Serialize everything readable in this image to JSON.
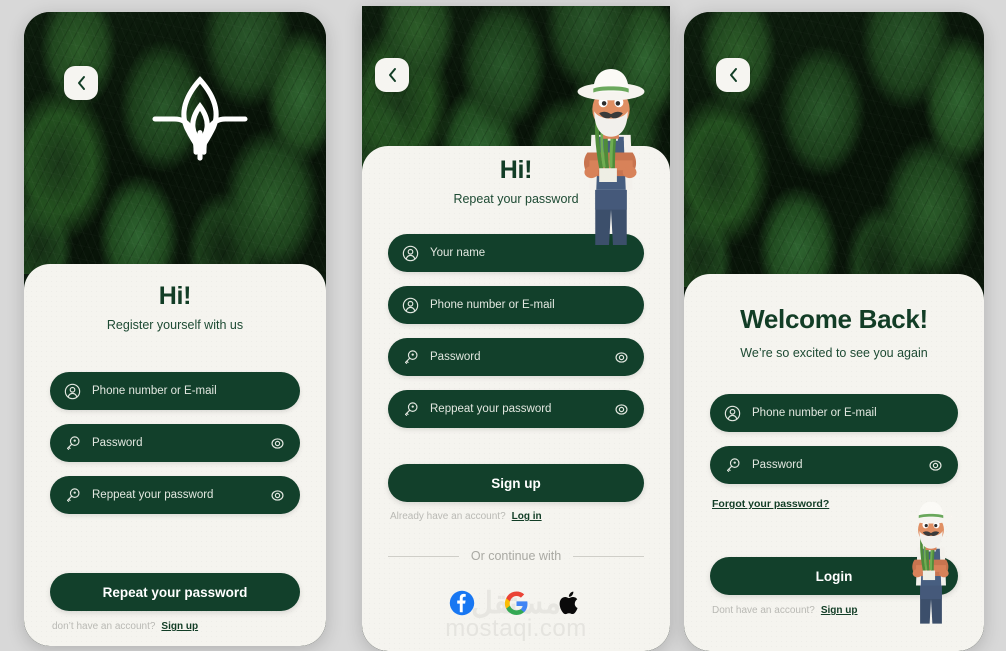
{
  "theme": {
    "page_bg": "#d8d8d8",
    "card_bg": "#f5f4ef",
    "brand_dark_green": "#12402b",
    "heading_green": "#123d26",
    "muted_text": "#b9b9b4",
    "field_text": "#e2e7e0"
  },
  "icons": {
    "back": "chevron-left-icon",
    "logo": "plant-sprout-logo",
    "user": "user-circle-icon",
    "key": "key-icon",
    "eye": "eye-visibility-icon",
    "facebook": "facebook-icon",
    "google": "google-icon",
    "apple": "apple-icon"
  },
  "screens": [
    {
      "id": "register",
      "back_label": "Back",
      "headline": "Hi!",
      "subtitle": "Register yourself with us",
      "fields": [
        {
          "name": "identifier",
          "placeholder": "Phone number or E-mail",
          "lead_icon": "user-circle-icon",
          "has_eye": false
        },
        {
          "name": "password",
          "placeholder": "Password",
          "lead_icon": "key-icon",
          "has_eye": true
        },
        {
          "name": "repeat-password",
          "placeholder": "Reppeat your password",
          "lead_icon": "key-icon",
          "has_eye": true
        }
      ],
      "primary_button": "Repeat your password",
      "footer_prompt": "don’t have an account?",
      "footer_link": "Sign up"
    },
    {
      "id": "signup",
      "back_label": "Back",
      "headline": "Hi!",
      "subtitle": "Repeat your password",
      "fields": [
        {
          "name": "your-name",
          "placeholder": "Your name",
          "lead_icon": "user-circle-icon",
          "has_eye": false
        },
        {
          "name": "identifier",
          "placeholder": "Phone number or E-mail",
          "lead_icon": "user-circle-icon",
          "has_eye": false
        },
        {
          "name": "password",
          "placeholder": "Password",
          "lead_icon": "key-icon",
          "has_eye": true
        },
        {
          "name": "repeat-password",
          "placeholder": "Reppeat your password",
          "lead_icon": "key-icon",
          "has_eye": true
        }
      ],
      "primary_button": "Sign up",
      "footer_prompt": "Already have an account?",
      "footer_link": "Log in",
      "divider_text": "Or continue with",
      "social": [
        {
          "name": "facebook",
          "label": "Facebook"
        },
        {
          "name": "google",
          "label": "Google"
        },
        {
          "name": "apple",
          "label": "Apple"
        }
      ],
      "watermark_arabic": "مستقل",
      "watermark_latin": "mostaqi.com"
    },
    {
      "id": "login",
      "back_label": "Back",
      "headline": "Welcome Back!",
      "subtitle": "We’re so excited to see you again",
      "fields": [
        {
          "name": "identifier",
          "placeholder": "Phone number or E-mail",
          "lead_icon": "user-circle-icon",
          "has_eye": false
        },
        {
          "name": "password",
          "placeholder": "Password",
          "lead_icon": "key-icon",
          "has_eye": true
        }
      ],
      "forgot_link": "Forgot your password?",
      "primary_button": "Login",
      "footer_prompt": "Dont have an account?",
      "footer_link": "Sign up"
    }
  ]
}
